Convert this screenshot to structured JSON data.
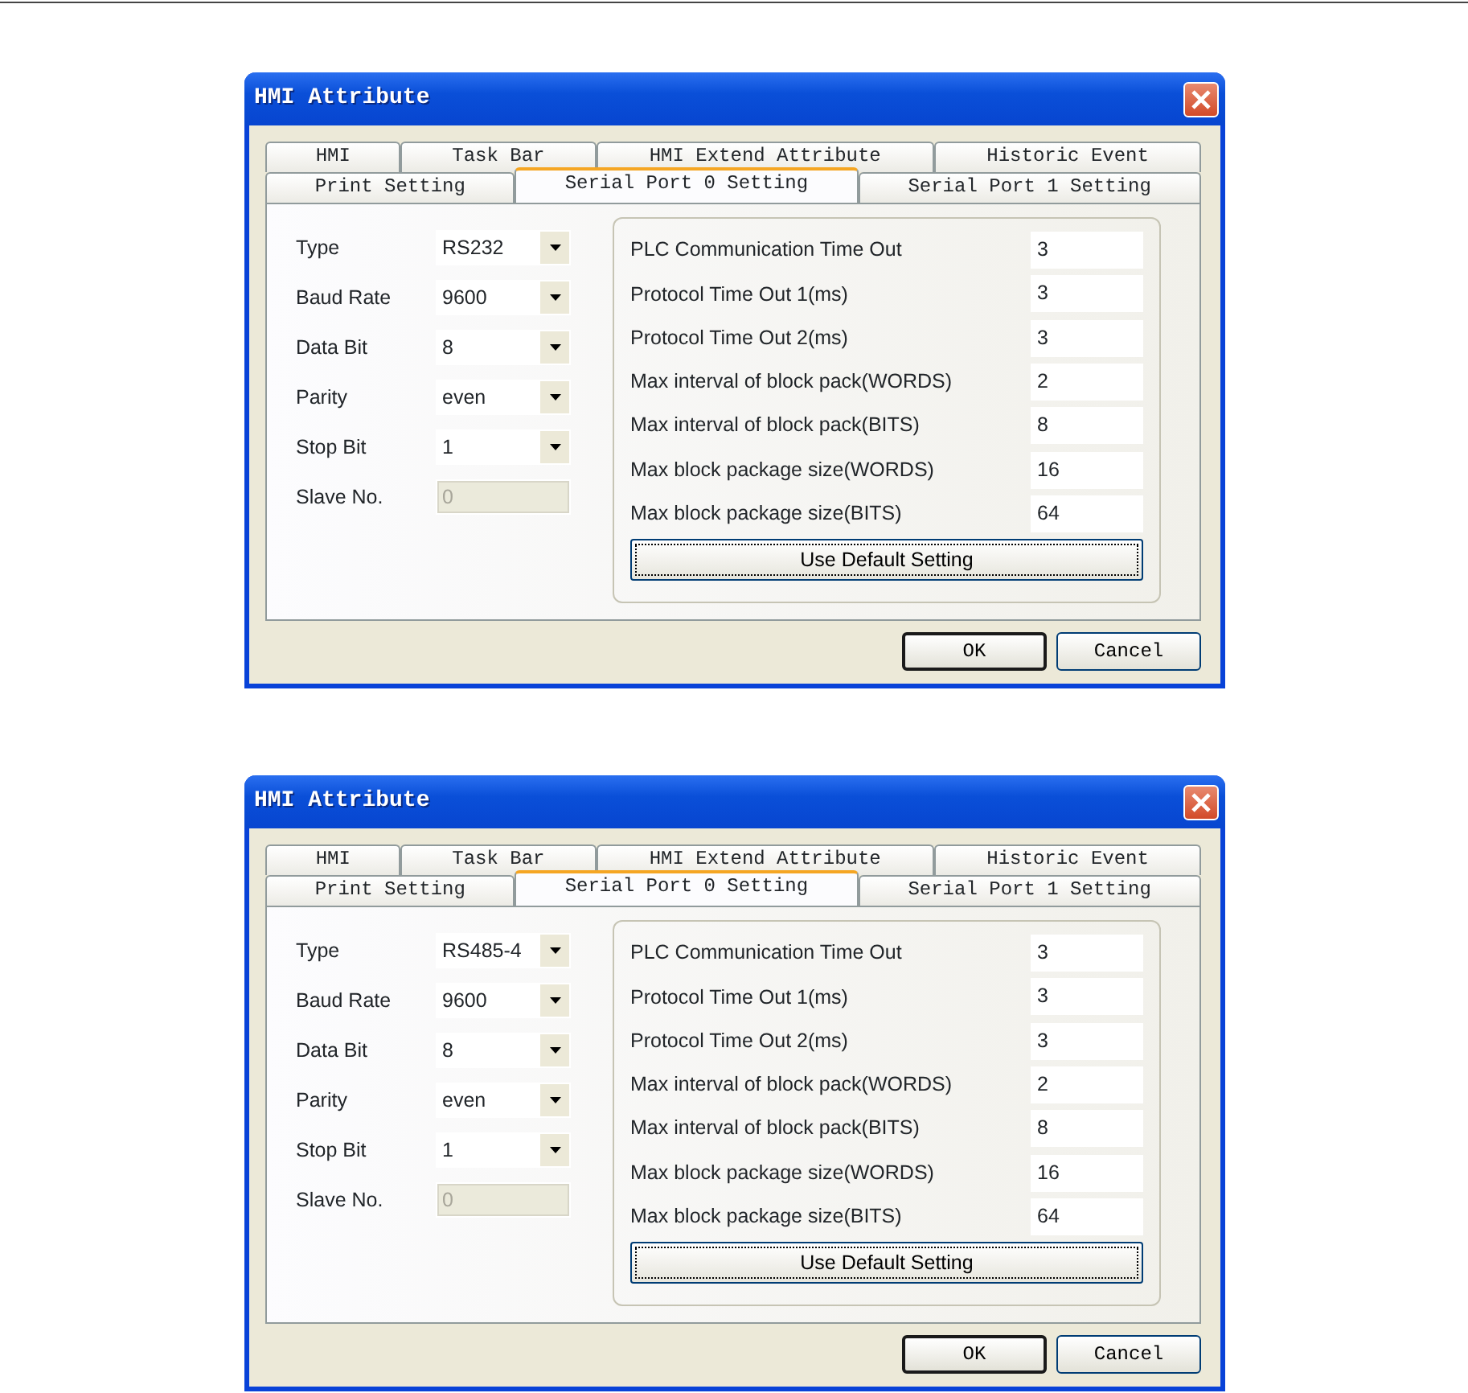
{
  "dialogs": [
    {
      "title": "HMI Attribute",
      "tab_rows": [
        [
          {
            "label": "HMI",
            "selected": false
          },
          {
            "label": "Task Bar",
            "selected": false
          },
          {
            "label": "HMI Extend Attribute",
            "selected": false
          },
          {
            "label": "Historic Event",
            "selected": false
          }
        ],
        [
          {
            "label": "Print Setting",
            "selected": false
          },
          {
            "label": "Serial Port 0 Setting",
            "selected": true
          },
          {
            "label": "Serial Port 1 Setting",
            "selected": false
          }
        ]
      ],
      "fields": [
        {
          "label": "Type",
          "kind": "combo",
          "value": "RS232",
          "disabled": false
        },
        {
          "label": "Baud Rate",
          "kind": "combo",
          "value": "9600",
          "disabled": false
        },
        {
          "label": "Data Bit",
          "kind": "combo",
          "value": "8",
          "disabled": false
        },
        {
          "label": "Parity",
          "kind": "combo",
          "value": "even",
          "disabled": false
        },
        {
          "label": "Stop Bit",
          "kind": "combo",
          "value": "1",
          "disabled": false
        },
        {
          "label": "Slave No.",
          "kind": "text",
          "value": "0",
          "disabled": true
        }
      ],
      "params": [
        {
          "label": "PLC Communication Time Out",
          "value": "3"
        },
        {
          "label": "Protocol Time Out 1(ms)",
          "value": "3"
        },
        {
          "label": "Protocol Time Out 2(ms)",
          "value": "3"
        },
        {
          "label": "Max interval of block pack(WORDS)",
          "value": "2"
        },
        {
          "label": "Max interval of block pack(BITS)",
          "value": "8"
        },
        {
          "label": "Max block package size(WORDS)",
          "value": "16"
        },
        {
          "label": "Max block package size(BITS)",
          "value": "64"
        }
      ],
      "group_button": "Use Default Setting",
      "buttons": [
        {
          "label": "OK",
          "default": true
        },
        {
          "label": "Cancel",
          "default": false
        }
      ]
    },
    {
      "title": "HMI Attribute",
      "tab_rows": [
        [
          {
            "label": "HMI",
            "selected": false
          },
          {
            "label": "Task Bar",
            "selected": false
          },
          {
            "label": "HMI Extend Attribute",
            "selected": false
          },
          {
            "label": "Historic Event",
            "selected": false
          }
        ],
        [
          {
            "label": "Print Setting",
            "selected": false
          },
          {
            "label": "Serial Port 0 Setting",
            "selected": true
          },
          {
            "label": "Serial Port 1 Setting",
            "selected": false
          }
        ]
      ],
      "fields": [
        {
          "label": "Type",
          "kind": "combo",
          "value": "RS485-4",
          "disabled": false
        },
        {
          "label": "Baud Rate",
          "kind": "combo",
          "value": "9600",
          "disabled": false
        },
        {
          "label": "Data Bit",
          "kind": "combo",
          "value": "8",
          "disabled": false
        },
        {
          "label": "Parity",
          "kind": "combo",
          "value": "even",
          "disabled": false
        },
        {
          "label": "Stop Bit",
          "kind": "combo",
          "value": "1",
          "disabled": false
        },
        {
          "label": "Slave No.",
          "kind": "text",
          "value": "0",
          "disabled": true
        }
      ],
      "params": [
        {
          "label": "PLC Communication Time Out",
          "value": "3"
        },
        {
          "label": "Protocol Time Out 1(ms)",
          "value": "3"
        },
        {
          "label": "Protocol Time Out 2(ms)",
          "value": "3"
        },
        {
          "label": "Max interval of block pack(WORDS)",
          "value": "2"
        },
        {
          "label": "Max interval of block pack(BITS)",
          "value": "8"
        },
        {
          "label": "Max block package size(WORDS)",
          "value": "16"
        },
        {
          "label": "Max block package size(BITS)",
          "value": "64"
        }
      ],
      "group_button": "Use Default Setting",
      "buttons": [
        {
          "label": "OK",
          "default": true
        },
        {
          "label": "Cancel",
          "default": false
        }
      ]
    }
  ]
}
